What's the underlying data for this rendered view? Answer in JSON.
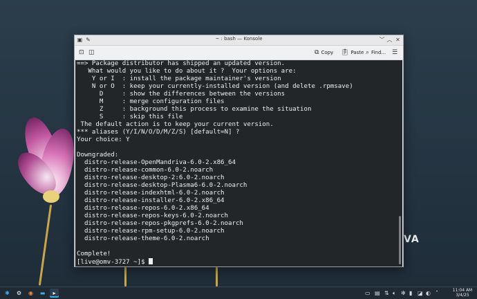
{
  "desktop": {
    "brand_text": "VA",
    "colors": {
      "wallpaper": "#263744",
      "accent": "#3daee9"
    }
  },
  "window": {
    "title": "~ : bash — Konsole",
    "app_icon": "terminal-icon",
    "pin_icon": "pin-icon",
    "controls": {
      "minimize": "﹀",
      "maximize": "︿",
      "close": "✕"
    }
  },
  "toolbar": {
    "new_tab_icon": "new-tab-icon",
    "split_icon": "split-view-icon",
    "copy_label": "Copy",
    "paste_label": "Paste",
    "find_label": "Find...",
    "menu_icon": "hamburger-menu-icon"
  },
  "terminal": {
    "lines": [
      "==> Package distributor has shipped an updated version.",
      "   What would you like to do about it ?  Your options are:",
      "    Y or I  : install the package maintainer's version",
      "    N or O  : keep your currently-installed version (and delete .rpmsave)",
      "      D     : show the differences between the versions",
      "      M     : merge configuration files",
      "      Z     : background this process to examine the situation",
      "      S     : skip this file",
      " The default action is to keep your current version.",
      "*** aliases (Y/I/N/O/D/M/Z/S) [default=N] ?",
      "Your choice: Y",
      "",
      "Downgraded:",
      "  distro-release-OpenMandriva-6.0-2.x86_64",
      "  distro-release-common-6.0-2.noarch",
      "  distro-release-desktop-2:6.0-2.noarch",
      "  distro-release-desktop-Plasma6-6.0-2.noarch",
      "  distro-release-indexhtml-6.0-2.noarch",
      "  distro-release-installer-6.0-2.x86_64",
      "  distro-release-repos-6.0-2.x86_64",
      "  distro-release-repos-keys-6.0-2.noarch",
      "  distro-release-repos-pkgprefs-6.0-2.noarch",
      "  distro-release-rpm-setup-6.0-2.noarch",
      "  distro-release-theme-6.0-2.noarch",
      "",
      "Complete!"
    ],
    "prompt": "[live@omv-3727 ~]$ "
  },
  "taskbar": {
    "launcher_icon": "application-launcher-icon",
    "apps": [
      "settings-icon",
      "browser-icon",
      "file-manager-icon",
      "terminal-icon"
    ],
    "tray_icons": [
      "monitor-icon",
      "clipboard-icon",
      "network-icon",
      "volume-icon",
      "bluetooth-icon",
      "battery-icon",
      "expand-tray-icon"
    ],
    "clock_time": "11:04 AM",
    "clock_date": "3/4/25"
  }
}
